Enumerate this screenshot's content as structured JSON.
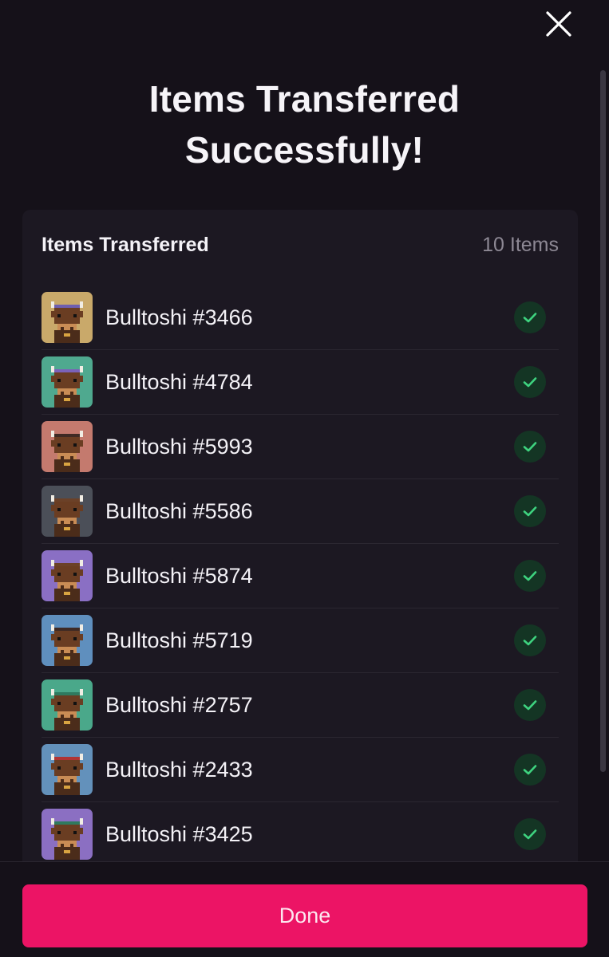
{
  "modal": {
    "title_line1": "Items Transferred",
    "title_line2": "Successfully!"
  },
  "card": {
    "title": "Items Transferred",
    "count": "10 Items"
  },
  "items": [
    {
      "label": "Bulltoshi #3466",
      "bg": "#c9a96a",
      "hat": "#6e5fb0"
    },
    {
      "label": "Bulltoshi #4784",
      "bg": "#4fa98f",
      "hat": "#7b62b8"
    },
    {
      "label": "Bulltoshi #5993",
      "bg": "#c47a6e",
      "hat": "#3f2a24"
    },
    {
      "label": "Bulltoshi #5586",
      "bg": "#4b4f58",
      "hat": "#6b4128"
    },
    {
      "label": "Bulltoshi #5874",
      "bg": "#8a6fc4",
      "hat": "#6b4128"
    },
    {
      "label": "Bulltoshi #5719",
      "bg": "#5f8fbe",
      "hat": "#3f2a24"
    },
    {
      "label": "Bulltoshi #2757",
      "bg": "#4aa88a",
      "hat": "#2f7a5f"
    },
    {
      "label": "Bulltoshi #2433",
      "bg": "#6391bb",
      "hat": "#b03434"
    },
    {
      "label": "Bulltoshi #3425",
      "bg": "#8b6fc2",
      "hat": "#2f7a5f"
    }
  ],
  "actions": {
    "done_label": "Done"
  },
  "colors": {
    "accent": "#ec1465",
    "success": "#3ed37f"
  }
}
